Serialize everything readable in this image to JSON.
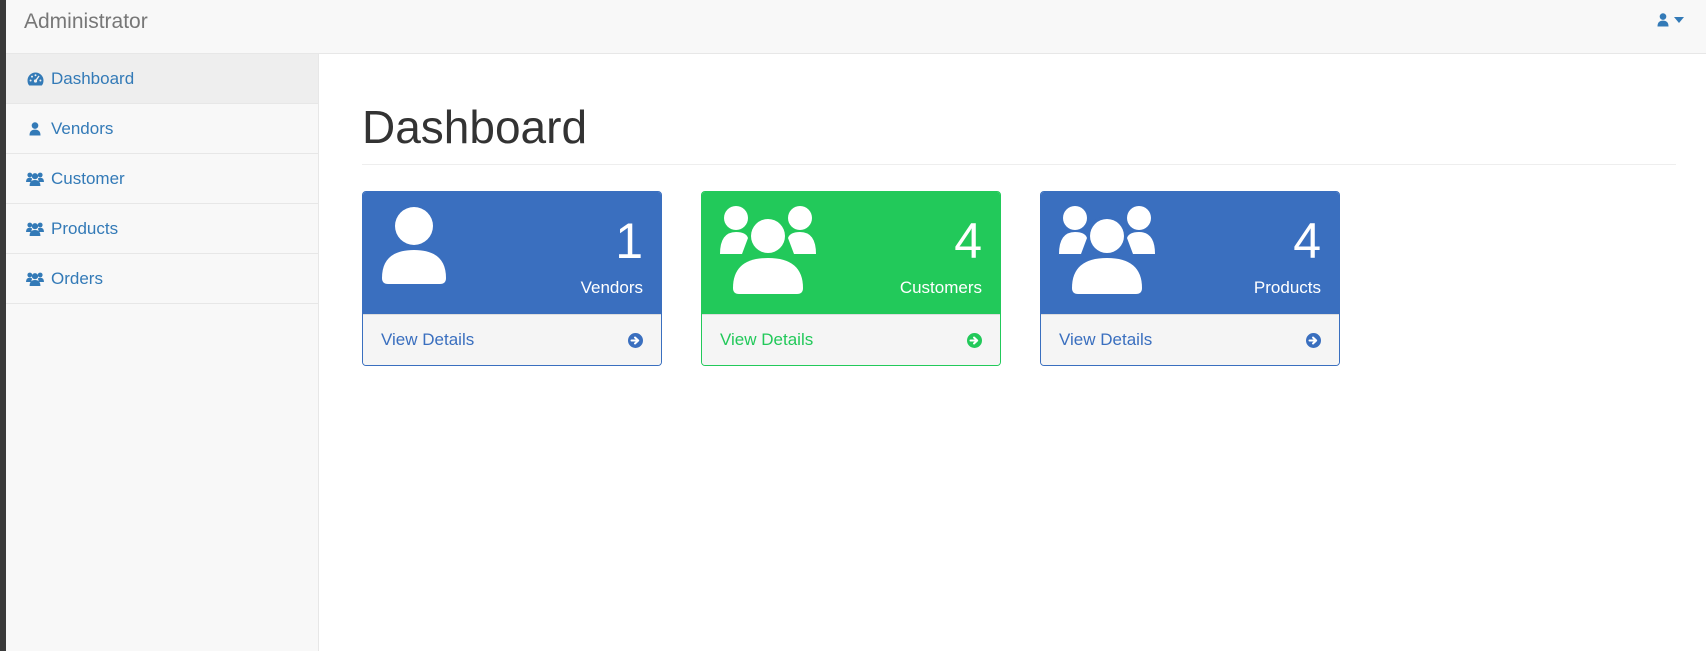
{
  "navbar": {
    "brand": "Administrator",
    "user_icon": "user-icon",
    "caret_icon": "caret-down-icon"
  },
  "sidebar": {
    "items": [
      {
        "label": "Dashboard",
        "icon": "dashboard-icon",
        "active": true
      },
      {
        "label": "Vendors",
        "icon": "user-icon",
        "active": false
      },
      {
        "label": "Customer",
        "icon": "users-icon",
        "active": false
      },
      {
        "label": "Products",
        "icon": "users-icon",
        "active": false
      },
      {
        "label": "Orders",
        "icon": "users-icon",
        "active": false
      }
    ]
  },
  "main": {
    "title": "Dashboard",
    "panels": [
      {
        "count": "1",
        "label": "Vendors",
        "link": "View Details",
        "color": "#3a6fbf",
        "icon": "user-icon",
        "arrow_icon": "arrow-circle-right-icon"
      },
      {
        "count": "4",
        "label": "Customers",
        "link": "View Details",
        "color": "#22c95a",
        "icon": "users-icon",
        "arrow_icon": "arrow-circle-right-icon"
      },
      {
        "count": "4",
        "label": "Products",
        "link": "View Details",
        "color": "#3a6fbf",
        "icon": "users-icon",
        "arrow_icon": "arrow-circle-right-icon"
      }
    ]
  },
  "colors": {
    "link": "#337ab7",
    "primary": "#3a6fbf",
    "success": "#22c95a"
  }
}
